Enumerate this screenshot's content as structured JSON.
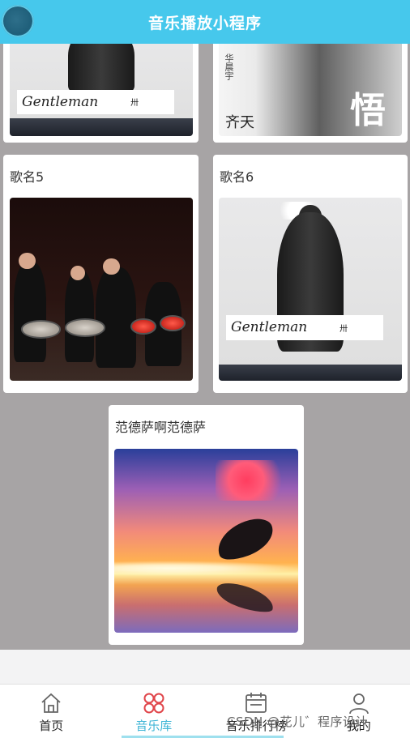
{
  "app": {
    "title": "音乐播放小程序"
  },
  "cards": [
    {
      "title": "歌名5",
      "cover_icon": "gentleman-cover"
    },
    {
      "title": "歌名6",
      "cover_icon": "gentleman-cover"
    },
    {
      "title": "范德萨啊范德萨",
      "cover_icon": "dolphin-sunset-cover"
    }
  ],
  "partial_cards": {
    "left": {
      "cover_text": "Gentleman",
      "cover_small": "卅"
    },
    "right": {
      "vertical_text": "华晨宇",
      "big_text_1": "齐",
      "big_text_2": "天",
      "calligraphy": "悟"
    }
  },
  "covers": {
    "card5_sign": "Gentleman",
    "card5_sign_small": "卅"
  },
  "tabs": [
    {
      "label": "首页",
      "icon": "home-icon",
      "active": false
    },
    {
      "label": "音乐库",
      "icon": "music-library-icon",
      "active": true
    },
    {
      "label": "音乐排行榜",
      "icon": "calendar-icon",
      "active": false
    },
    {
      "label": "我的",
      "icon": "user-icon",
      "active": false
    }
  ],
  "watermark": "CSDN @花儿゛程序设计",
  "colors": {
    "header": "#46c8ec",
    "active_tab": "#3fb5d6",
    "active_icon": "#e0454a"
  }
}
